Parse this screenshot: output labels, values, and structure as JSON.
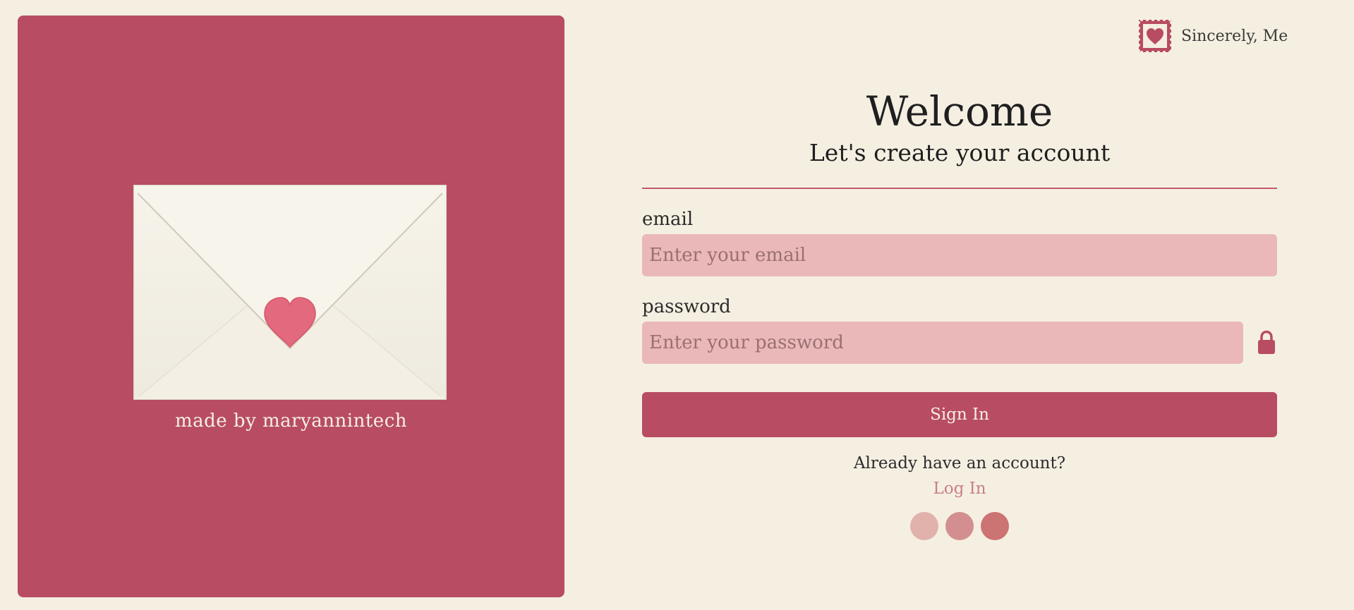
{
  "brand": {
    "name": "Sincerely, Me",
    "icon": "heart-stamp-icon"
  },
  "left_panel": {
    "credit": "made by maryannintech",
    "image": "envelope-heart-seal"
  },
  "header": {
    "title": "Welcome",
    "subtitle": "Let's create your account"
  },
  "form": {
    "email_label": "email",
    "email_placeholder": "Enter your email",
    "email_value": "",
    "password_label": "password",
    "password_placeholder": "Enter your password",
    "password_value": "",
    "password_icon": "lock-icon",
    "submit_label": "Sign In"
  },
  "footer": {
    "prompt": "Already have an account?",
    "login_label": "Log In"
  },
  "theme_swatches": [
    {
      "color": "#e0b2ab"
    },
    {
      "color": "#d38f8f"
    },
    {
      "color": "#cc7373"
    }
  ],
  "colors": {
    "background": "#f5efe2",
    "accent": "#b84c63",
    "input_bg": "#eab8b8",
    "link": "#c97f87"
  }
}
